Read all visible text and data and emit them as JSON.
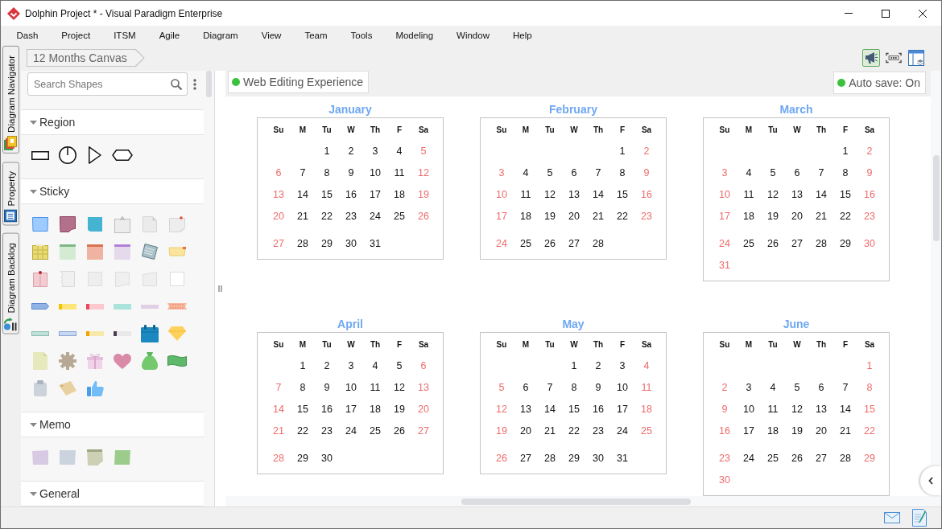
{
  "window": {
    "title": "Dolphin Project * - Visual Paradigm Enterprise"
  },
  "menu": [
    "Dash",
    "Project",
    "ITSM",
    "Agile",
    "Diagram",
    "View",
    "Team",
    "Tools",
    "Modeling",
    "Window",
    "Help"
  ],
  "side_tabs": [
    {
      "label": "Diagram Navigator",
      "kind": "navigator"
    },
    {
      "label": "Property",
      "kind": "property"
    },
    {
      "label": "Diagram Backlog",
      "kind": "backlog"
    }
  ],
  "breadcrumb": "12 Months Canvas",
  "toolbar": [
    {
      "kind": "announce",
      "pressed": true
    },
    {
      "kind": "fit",
      "pressed": false
    },
    {
      "kind": "layout",
      "pressed": false
    }
  ],
  "shapes_panel": {
    "search": {
      "placeholder": "Search Shapes"
    },
    "sections": [
      {
        "title": "Region",
        "kind": "region",
        "expanded": true
      },
      {
        "title": "Sticky",
        "kind": "sticky",
        "expanded": true
      },
      {
        "title": "Memo",
        "kind": "memo",
        "expanded": true
      },
      {
        "title": "General",
        "kind": "general",
        "expanded": true
      }
    ]
  },
  "canvas": {
    "badges": [
      {
        "label": "Web Editing Experience",
        "active": true
      },
      {
        "label": "Auto save: On",
        "active": true
      }
    ],
    "months": [
      {
        "name": "January",
        "weekdays": [
          {
            "label": "Su",
            "weekend": true
          },
          {
            "label": "M",
            "weekend": false
          },
          {
            "label": "Tu",
            "weekend": false
          },
          {
            "label": "W",
            "weekend": false
          },
          {
            "label": "Th",
            "weekend": false
          },
          {
            "label": "F",
            "weekend": false
          },
          {
            "label": "Sa",
            "weekend": true
          }
        ],
        "weeks": [
          [
            "1",
            "2",
            "3",
            "4",
            "5"
          ],
          [
            "6",
            "7",
            "8",
            "9",
            "10",
            "11",
            "12"
          ],
          [
            "13",
            "14",
            "15",
            "16",
            "17",
            "18",
            "19"
          ],
          [
            "20",
            "21",
            "22",
            "23",
            "24",
            "25",
            "26"
          ],
          [
            "27",
            "28",
            "29",
            "30",
            "31"
          ]
        ]
      },
      {
        "name": "February",
        "weekdays": [
          {
            "label": "Su",
            "weekend": true
          },
          {
            "label": "M",
            "weekend": false
          },
          {
            "label": "Tu",
            "weekend": false
          },
          {
            "label": "W",
            "weekend": false
          },
          {
            "label": "Th",
            "weekend": false
          },
          {
            "label": "F",
            "weekend": false
          },
          {
            "label": "Sa",
            "weekend": true
          }
        ],
        "weeks": [
          [
            "1",
            "2"
          ],
          [
            "3",
            "4",
            "5",
            "6",
            "7",
            "8",
            "9"
          ],
          [
            "10",
            "11",
            "12",
            "13",
            "14",
            "15",
            "16"
          ],
          [
            "17",
            "18",
            "19",
            "20",
            "21",
            "22",
            "23"
          ],
          [
            "24",
            "25",
            "26",
            "27",
            "28"
          ]
        ]
      },
      {
        "name": "March",
        "weekdays": [
          {
            "label": "Su",
            "weekend": true
          },
          {
            "label": "M",
            "weekend": false
          },
          {
            "label": "Tu",
            "weekend": false
          },
          {
            "label": "W",
            "weekend": false
          },
          {
            "label": "Th",
            "weekend": false
          },
          {
            "label": "F",
            "weekend": false
          },
          {
            "label": "Sa",
            "weekend": true
          }
        ],
        "weeks": [
          [
            "1",
            "2"
          ],
          [
            "3",
            "4",
            "5",
            "6",
            "7",
            "8",
            "9"
          ],
          [
            "10",
            "11",
            "12",
            "13",
            "14",
            "15",
            "16"
          ],
          [
            "17",
            "18",
            "19",
            "20",
            "21",
            "22",
            "23"
          ],
          [
            "24",
            "25",
            "26",
            "27",
            "28",
            "29",
            "30"
          ],
          [
            "31"
          ]
        ]
      },
      {
        "name": "April",
        "weekdays": [
          {
            "label": "Su",
            "weekend": true
          },
          {
            "label": "M",
            "weekend": false
          },
          {
            "label": "Tu",
            "weekend": false
          },
          {
            "label": "W",
            "weekend": false
          },
          {
            "label": "Th",
            "weekend": false
          },
          {
            "label": "F",
            "weekend": false
          },
          {
            "label": "Sa",
            "weekend": true
          }
        ],
        "weeks": [
          [
            "1",
            "2",
            "3",
            "4",
            "5",
            "6"
          ],
          [
            "7",
            "8",
            "9",
            "10",
            "11",
            "12",
            "13"
          ],
          [
            "14",
            "15",
            "16",
            "17",
            "18",
            "19",
            "20"
          ],
          [
            "21",
            "22",
            "23",
            "24",
            "25",
            "26",
            "27"
          ],
          [
            "28",
            "29",
            "30"
          ]
        ]
      },
      {
        "name": "May",
        "weekdays": [
          {
            "label": "Su",
            "weekend": true
          },
          {
            "label": "M",
            "weekend": false
          },
          {
            "label": "Tu",
            "weekend": false
          },
          {
            "label": "W",
            "weekend": false
          },
          {
            "label": "Th",
            "weekend": false
          },
          {
            "label": "F",
            "weekend": false
          },
          {
            "label": "Sa",
            "weekend": true
          }
        ],
        "weeks": [
          [
            "1",
            "2",
            "3",
            "4"
          ],
          [
            "5",
            "6",
            "7",
            "8",
            "9",
            "10",
            "11"
          ],
          [
            "12",
            "13",
            "14",
            "15",
            "16",
            "17",
            "18"
          ],
          [
            "19",
            "20",
            "21",
            "22",
            "23",
            "24",
            "25"
          ],
          [
            "26",
            "27",
            "28",
            "29",
            "30",
            "31"
          ]
        ]
      },
      {
        "name": "June",
        "weekdays": [
          {
            "label": "Su",
            "weekend": true
          },
          {
            "label": "M",
            "weekend": false
          },
          {
            "label": "Tu",
            "weekend": false
          },
          {
            "label": "W",
            "weekend": false
          },
          {
            "label": "Th",
            "weekend": false
          },
          {
            "label": "F",
            "weekend": false
          },
          {
            "label": "Sa",
            "weekend": true
          }
        ],
        "weeks": [
          [
            "1"
          ],
          [
            "2",
            "3",
            "4",
            "5",
            "6",
            "7",
            "8"
          ],
          [
            "9",
            "10",
            "11",
            "12",
            "13",
            "14",
            "15"
          ],
          [
            "16",
            "17",
            "18",
            "19",
            "20",
            "21",
            "22"
          ],
          [
            "23",
            "24",
            "25",
            "26",
            "27",
            "28",
            "29"
          ],
          [
            "30"
          ]
        ]
      }
    ]
  }
}
